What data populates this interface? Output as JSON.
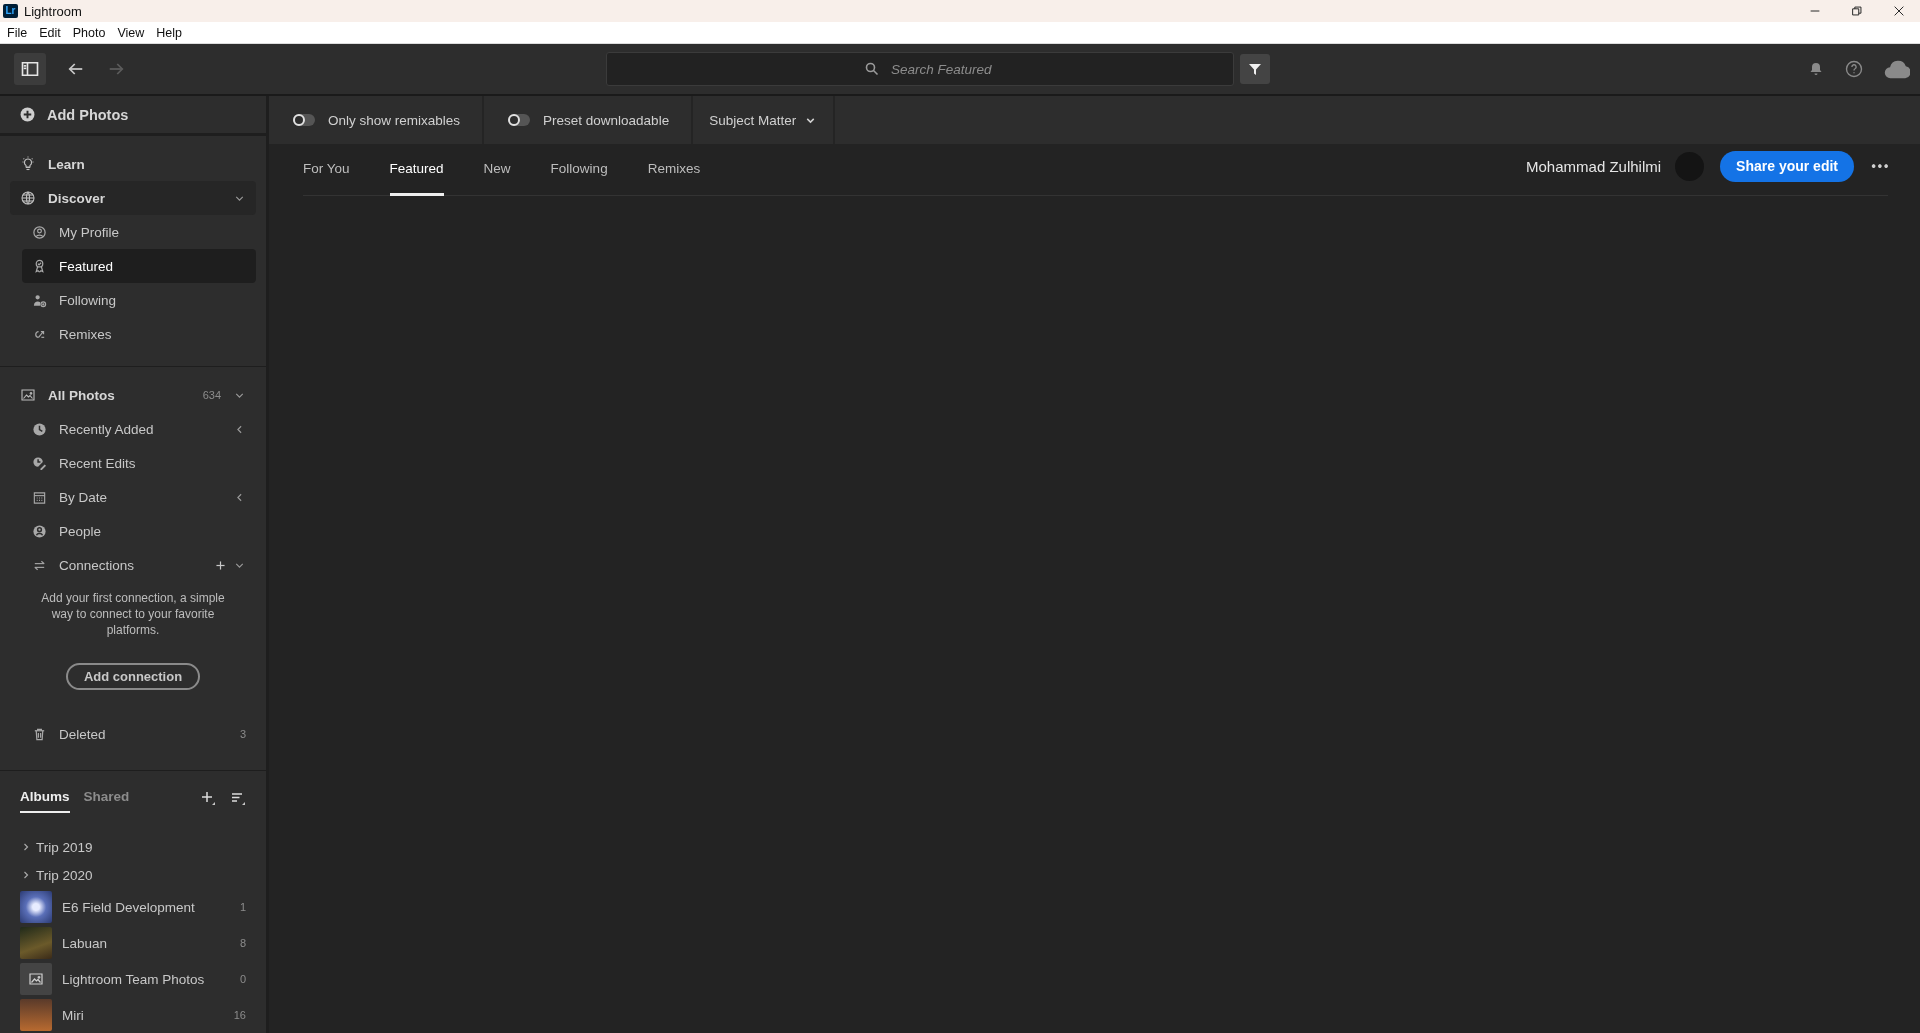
{
  "title_bar": {
    "logo": "Lr",
    "title": "Lightroom"
  },
  "menu": [
    "File",
    "Edit",
    "Photo",
    "View",
    "Help"
  ],
  "toolbar": {
    "search": {
      "placeholder": "Search Featured"
    }
  },
  "sidebar": {
    "add_photos": "Add Photos",
    "learn": {
      "label": "Learn"
    },
    "discover": {
      "label": "Discover",
      "expanded": true,
      "items": [
        {
          "label": "My Profile",
          "selected": false
        },
        {
          "label": "Featured",
          "selected": true
        },
        {
          "label": "Following",
          "selected": false
        },
        {
          "label": "Remixes",
          "selected": false
        }
      ]
    },
    "all_photos": {
      "label": "All Photos",
      "count": "634",
      "expanded": true,
      "items": [
        {
          "label": "Recently Added",
          "expanded": false
        },
        {
          "label": "Recent Edits"
        },
        {
          "label": "By Date",
          "expanded": false
        },
        {
          "label": "People"
        },
        {
          "label": "Connections",
          "expanded": true
        }
      ]
    },
    "connections": {
      "hint": "Add your first connection, a simple way to connect to your favorite platforms.",
      "button": "Add connection"
    },
    "deleted": {
      "label": "Deleted",
      "count": "3"
    },
    "album_tabs": [
      {
        "label": "Albums",
        "selected": true
      },
      {
        "label": "Shared",
        "selected": false
      }
    ],
    "album_folders": [
      {
        "label": "Trip 2019",
        "expanded": false
      },
      {
        "label": "Trip 2020",
        "expanded": false
      }
    ],
    "albums": [
      {
        "name": "E6 Field Development",
        "count": "1",
        "kind": "photo"
      },
      {
        "name": "Labuan",
        "count": "8",
        "kind": "photo"
      },
      {
        "name": "Lightroom Team Photos",
        "count": "0",
        "kind": "empty"
      },
      {
        "name": "Miri",
        "count": "16",
        "kind": "photo"
      }
    ]
  },
  "filters": {
    "toggles": [
      {
        "label": "Only show remixables",
        "on": false
      },
      {
        "label": "Preset downloadable",
        "on": false
      }
    ],
    "dropdown": "Subject Matter"
  },
  "tabs": [
    {
      "label": "For You",
      "selected": false
    },
    {
      "label": "Featured",
      "selected": true
    },
    {
      "label": "New",
      "selected": false
    },
    {
      "label": "Following",
      "selected": false
    },
    {
      "label": "Remixes",
      "selected": false
    }
  ],
  "profile": {
    "name": "Mohammad Zulhilmi",
    "share_button": "Share your edit"
  }
}
